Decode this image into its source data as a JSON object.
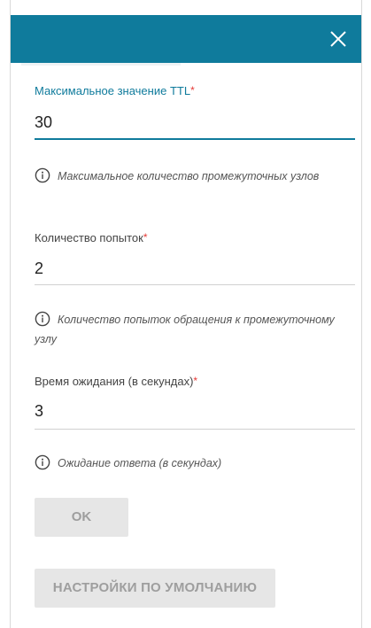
{
  "colors": {
    "header": "#0f7b9c",
    "accent": "#0f7b9c",
    "required": "#e53935",
    "button_bg": "#e6e6e6",
    "button_text": "#9e9e9e"
  },
  "dialog": {
    "close_icon": "close-icon"
  },
  "fields": [
    {
      "label": "Максимальное значение TTL",
      "required_mark": "*",
      "value": "30",
      "focused": true,
      "hint": "Максимальное количество промежуточных узлов"
    },
    {
      "label": "Количество попыток",
      "required_mark": "*",
      "value": "2",
      "focused": false,
      "hint": "Количество попыток обращения к промежуточному узлу"
    },
    {
      "label": "Время ожидания (в секундах)",
      "required_mark": "*",
      "value": "3",
      "focused": false,
      "hint": "Ожидание ответа (в секундах)"
    }
  ],
  "buttons": {
    "ok_label": "OK",
    "defaults_label": "НАСТРОЙКИ ПО УМОЛЧАНИЮ"
  }
}
